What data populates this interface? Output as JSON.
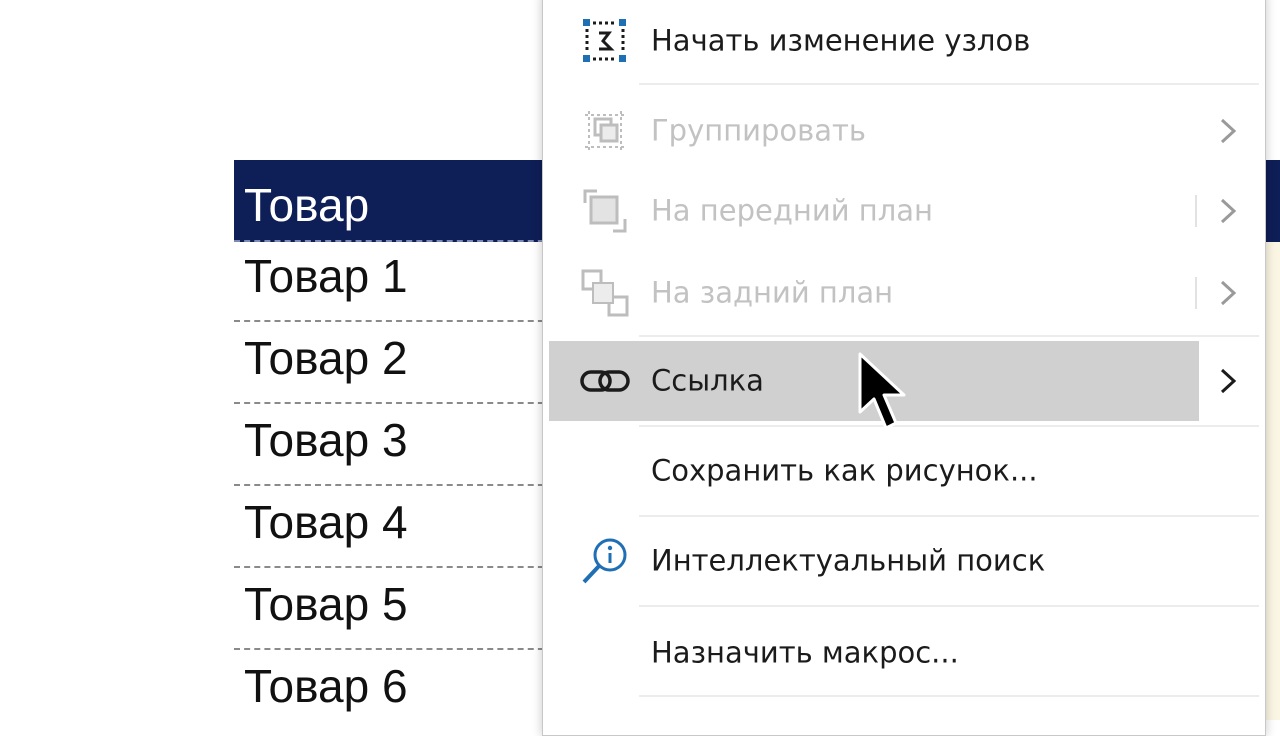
{
  "sheet": {
    "header": "Товар",
    "rows": [
      "Товар 1",
      "Товар 2",
      "Товар 3",
      "Товар 4",
      "Товар 5",
      "Товар 6"
    ]
  },
  "menu": {
    "items": [
      {
        "label": "Начать изменение узлов",
        "icon": "edit-points-icon",
        "enabled": true
      },
      {
        "label": "Группировать",
        "icon": "group-icon",
        "enabled": false,
        "submenu": true
      },
      {
        "label": "На передний план",
        "icon": "bring-forward-icon",
        "enabled": false,
        "submenu": true
      },
      {
        "label": "На задний план",
        "icon": "send-backward-icon",
        "enabled": false,
        "submenu": true
      },
      {
        "label": "Ссылка",
        "icon": "link-icon",
        "enabled": true,
        "submenu": true,
        "highlighted": true
      },
      {
        "label": "Сохранить как рисунок...",
        "enabled": true
      },
      {
        "label": "Интеллектуальный поиск",
        "icon": "smart-lookup-icon",
        "enabled": true
      },
      {
        "label": "Назначить макрос...",
        "enabled": true
      }
    ]
  },
  "colors": {
    "header_fill": "#0e1e57",
    "highlight": "#d0d0d0",
    "accent_icon": "#1f6fb5",
    "disabled_text": "#c2c2c2"
  }
}
